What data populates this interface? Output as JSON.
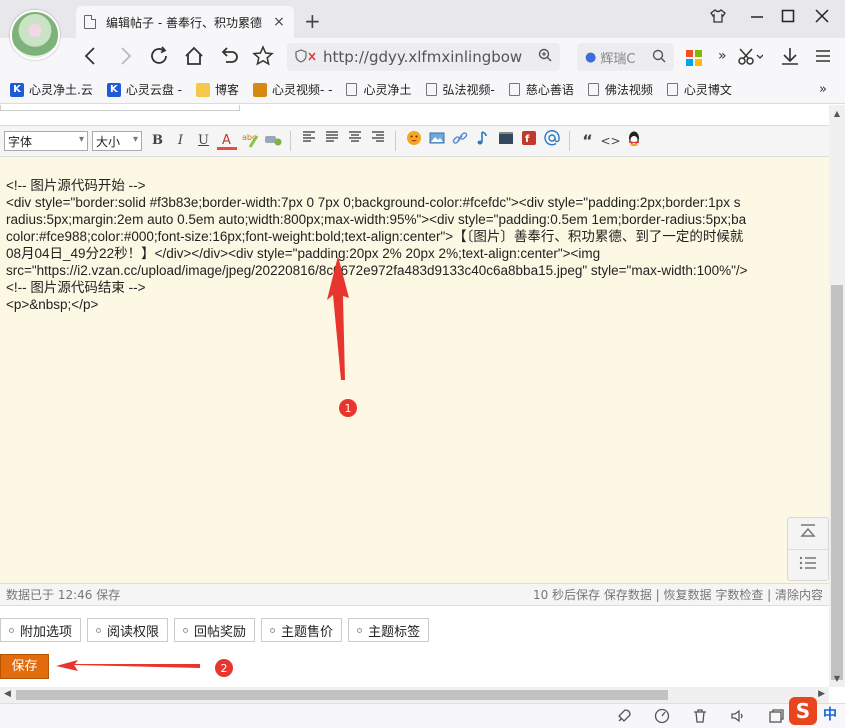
{
  "browser": {
    "tab_title": "编辑帖子 - 善奉行、积功累德",
    "tab_close": "×",
    "new_tab": "+",
    "url": "http://gdyy.xlfmxinlingbow",
    "search_placeholder": "辉瑞C",
    "more_chevrons": "»",
    "bookmarks": [
      {
        "label": "心灵净土.云",
        "icon": "K",
        "color": "#1e5bd6"
      },
      {
        "label": "心灵云盘 -",
        "icon": "K",
        "color": "#1e5bd6"
      },
      {
        "label": "博客",
        "icon": "",
        "color": "#f2c94c"
      },
      {
        "label": "心灵视频- -",
        "icon": "",
        "color": "#d48a12"
      },
      {
        "label": "心灵净土",
        "icon": "doc"
      },
      {
        "label": "弘法视频-",
        "icon": "doc"
      },
      {
        "label": "慈心善语",
        "icon": "doc"
      },
      {
        "label": "佛法视频",
        "icon": "doc"
      },
      {
        "label": "心灵博文",
        "icon": "doc"
      }
    ]
  },
  "toolbar": {
    "font_label": "字体",
    "size_label": "大小",
    "bold": "B",
    "italic": "I",
    "underline": "U",
    "color": "A",
    "quote": "“",
    "code": "<>"
  },
  "editor": {
    "lines": [
      "<!-- 图片源代码开始 -->",
      "<div style=\"border:solid #f3b83e;border-width:7px 0 7px 0;background-color:#fcefdc\"><div style=\"padding:2px;border:1px s",
      "radius:5px;margin:2em auto 0.5em auto;width:800px;max-width:95%\"><div style=\"padding:0.5em 1em;border-radius:5px;ba",
      "color:#fce988;color:#000;font-size:16px;font-weight:bold;text-align:center\">【〔图片〕善奉行、积功累德、到了一定的时候就",
      "08月04日_49分22秒！】</div></div><div style=\"padding:20px 2% 20px 2%;text-align:center\"><img",
      "src=\"https://i2.vzan.cc/upload/image/jpeg/20220816/8c0672e972fa483d9133c40c6a8bba15.jpeg\" style=\"max-width:100%\"/>",
      "<!-- 图片源代码结束 -->",
      "<p>&nbsp;</p>"
    ]
  },
  "status": {
    "left": "数据已于 12:46 保存",
    "right": "10 秒后保存  保存数据 | 恢复数据    字数检查 | 清除内容"
  },
  "options": [
    "附加选项",
    "阅读权限",
    "回帖奖励",
    "主题售价",
    "主题标签"
  ],
  "save_label": "保存",
  "annotations": {
    "marker1": "1",
    "marker2": "2"
  },
  "ime": {
    "logo": "S",
    "mode": "中"
  }
}
